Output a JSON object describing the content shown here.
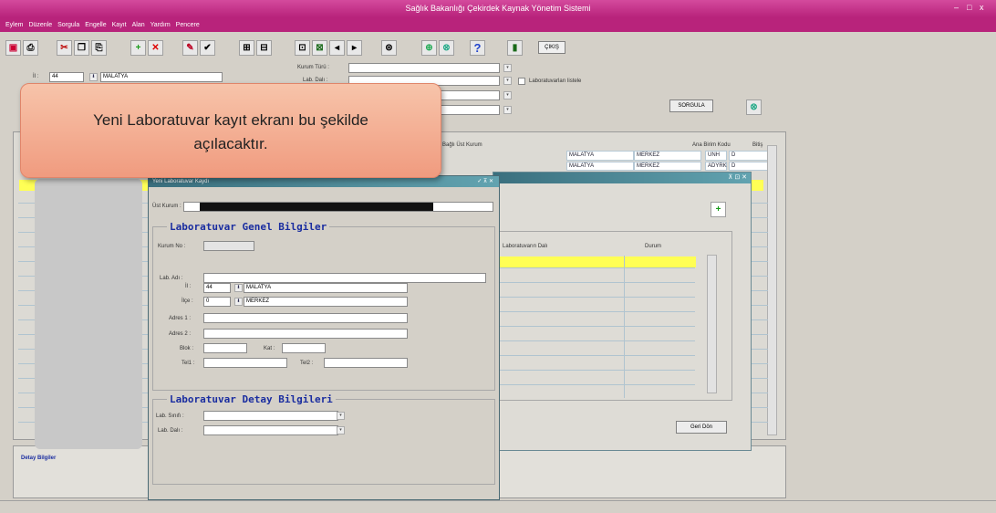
{
  "window": {
    "title": "Sağlık Bakanlığı Çekirdek Kaynak Yönetim Sistemi",
    "controls": [
      "–",
      "□",
      "x"
    ]
  },
  "menu": [
    "Eylem",
    "Düzenle",
    "Sorgula",
    "Engelle",
    "Kayıt",
    "Alan",
    "Yardım",
    "Pencere"
  ],
  "toolbar": {
    "exit_label": "ÇIKIŞ"
  },
  "filter": {
    "il_label": "İl :",
    "il_code": "44",
    "il_name": "MALATYA",
    "kurum_turu_label": "Kurum Türü :",
    "lab_dal_label": "Lab. Dalı :",
    "checkbox_label": "Laboratuvarları listele",
    "query_button": "SORGULA"
  },
  "tooltip": {
    "line1": "Yeni Laboratuvar kayıt ekranı bu şekilde",
    "line2": "açılacaktır."
  },
  "background_grid": {
    "col_bagli": "Bağlı Üst Kurum",
    "col_ana": "Ana Birim Kodu",
    "col_dd": "Bitiş",
    "rows": [
      {
        "il": "MALATYA",
        "ilce": "MERKEZ",
        "kod": "UNH",
        "dd": "D"
      },
      {
        "il": "MALATYA",
        "ilce": "MERKEZ",
        "kod": "ADYRK",
        "dd": "D"
      }
    ],
    "detail_label": "Detay Bilgiler"
  },
  "sub_window": {
    "col_dal": "Laboratuvarın Dalı",
    "col_durum": "Durum",
    "back_button": "Geri Dön"
  },
  "dialog": {
    "title": "Yeni Laboratuvar Kaydı",
    "title_controls": "✓ ⊼ ✕",
    "ust_kurum_label": "Üst Kurum :",
    "general_title": "Laboratuvar Genel Bilgiler",
    "kurum_no_label": "Kurum No :",
    "lab_adi_label": "Lab. Adı :",
    "il_label": "İl :",
    "il_code": "44",
    "il_name": "MALATYA",
    "ilce_label": "İlçe :",
    "ilce_code": "0",
    "ilce_name": "MERKEZ",
    "adres1_label": "Adres 1 :",
    "adres2_label": "Adres 2 :",
    "blok_label": "Blok :",
    "kat_label": "Kat :",
    "tel1_label": "Tel1 :",
    "tel2_label": "Tel2 :",
    "detail_title": "Laboratuvar Detay Bilgileri",
    "lab_sinifi_label": "Lab. Sınıfı :",
    "lab_dali_label": "Lab. Dalı :"
  }
}
